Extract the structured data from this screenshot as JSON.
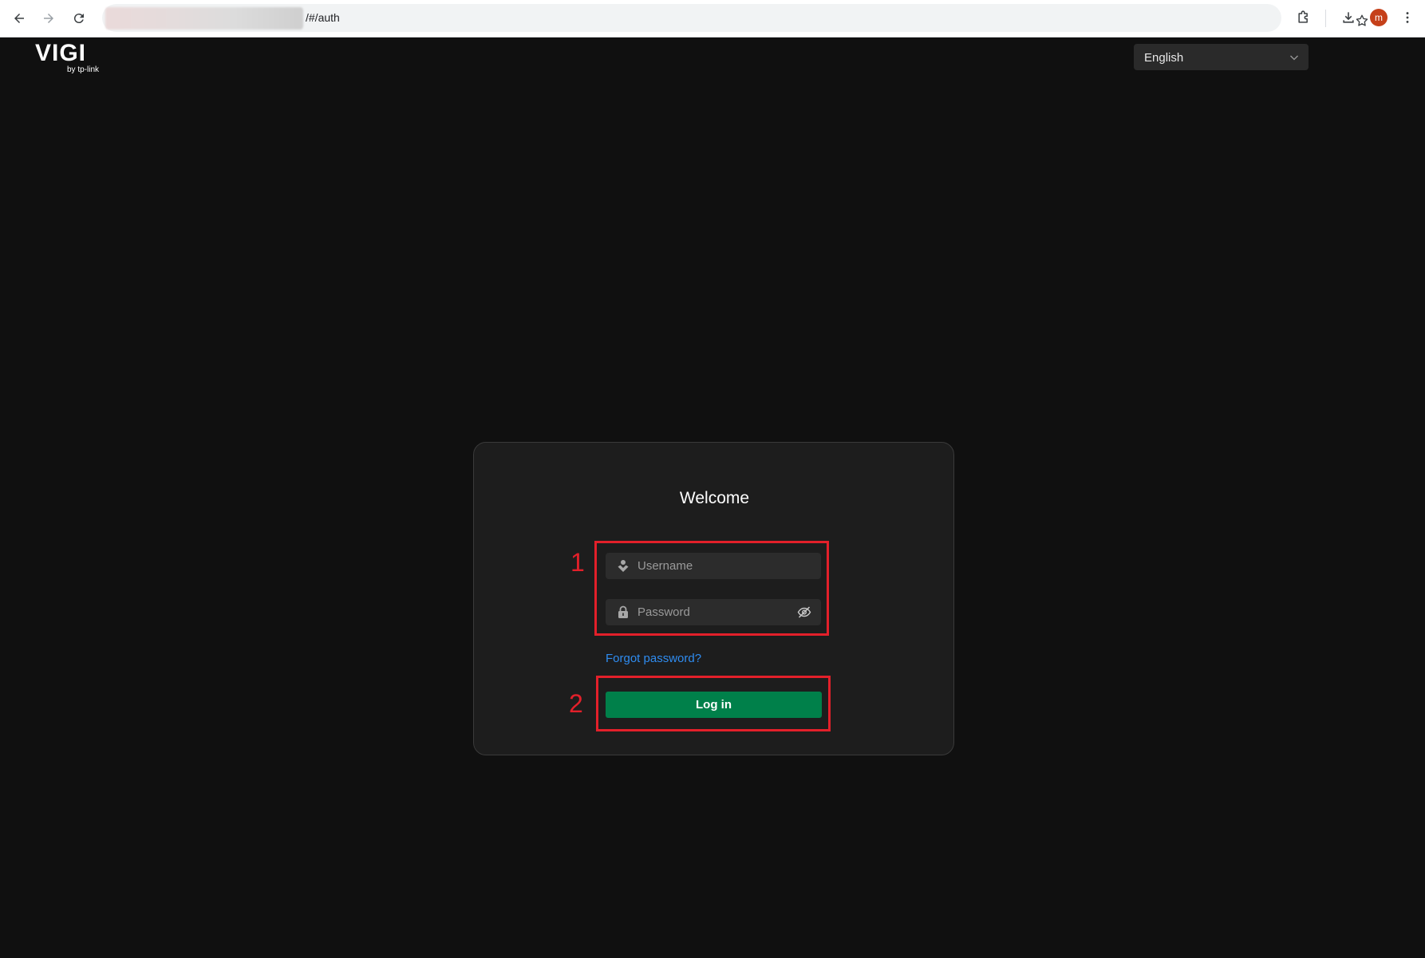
{
  "browser": {
    "url_suffix": "/#/auth",
    "avatar_letter": "m"
  },
  "header": {
    "logo_text": "VIGI",
    "logo_sub": "by tp-link",
    "language": "English"
  },
  "login": {
    "title": "Welcome",
    "username_placeholder": "Username",
    "password_placeholder": "Password",
    "forgot_label": "Forgot password?",
    "login_label": "Log in"
  },
  "annotations": {
    "step1": "1",
    "step2": "2"
  },
  "colors": {
    "background": "#101010",
    "card": "#1d1d1d",
    "primary_button": "#00804a",
    "link": "#2f8cf0",
    "annotation": "#e3202a"
  }
}
